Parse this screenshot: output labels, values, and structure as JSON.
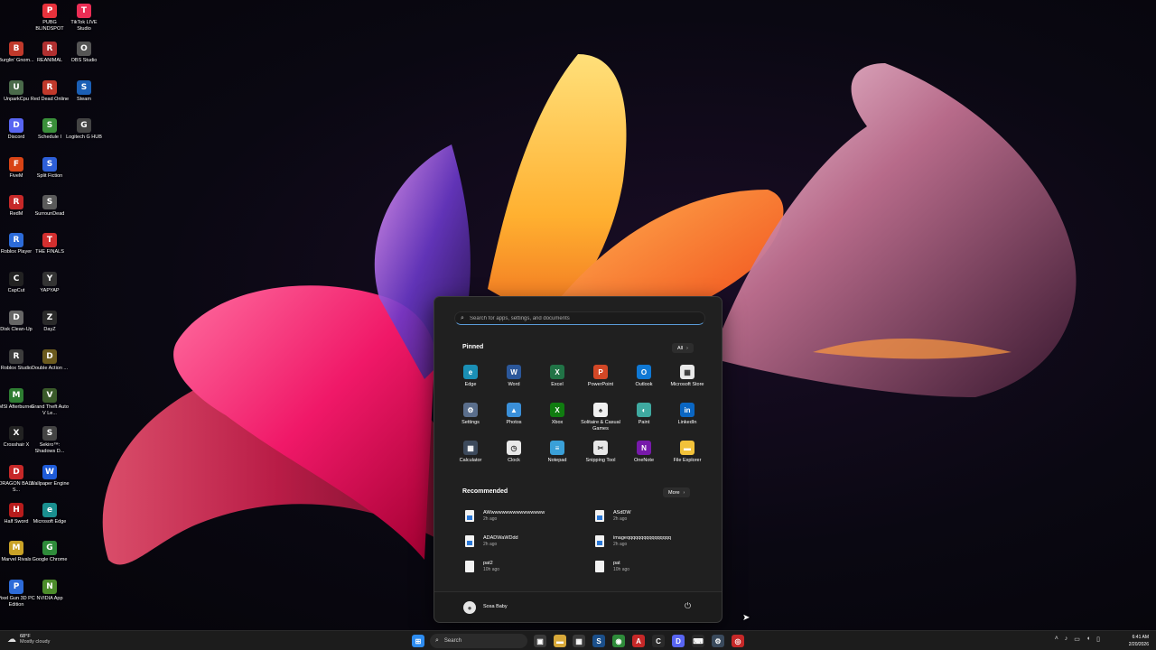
{
  "desktop": {
    "icons": [
      {
        "label": "PUBG BLINDSPOT",
        "color": "#e8323c",
        "glyph": "P"
      },
      {
        "label": "TikTok LIVE Studio",
        "color": "#ea2d55",
        "glyph": "T"
      },
      {
        "label": "Burglin' Gnom...",
        "color": "#c0392b",
        "glyph": "B"
      },
      {
        "label": "REANIMAL",
        "color": "#b03030",
        "glyph": "R"
      },
      {
        "label": "OBS Studio",
        "color": "#555555",
        "glyph": "O"
      },
      {
        "label": "UnparkCpu",
        "color": "#4a6a4a",
        "glyph": "U"
      },
      {
        "label": "Red Dead Online",
        "color": "#c0392b",
        "glyph": "R"
      },
      {
        "label": "Steam",
        "color": "#1b5fb5",
        "glyph": "S"
      },
      {
        "label": "Discord",
        "color": "#5865f2",
        "glyph": "D"
      },
      {
        "label": "Schedule I",
        "color": "#3a8f3a",
        "glyph": "S"
      },
      {
        "label": "Logitech G HUB",
        "color": "#444444",
        "glyph": "G"
      },
      {
        "label": "FiveM",
        "color": "#d84315",
        "glyph": "F"
      },
      {
        "label": "Split Fiction",
        "color": "#2d5fd8",
        "glyph": "S"
      },
      {
        "label": "RedM",
        "color": "#c62828",
        "glyph": "R"
      },
      {
        "label": "SurrounDead",
        "color": "#5a5a5a",
        "glyph": "S"
      },
      {
        "label": "Roblox Player",
        "color": "#2c6bd8",
        "glyph": "R"
      },
      {
        "label": "THE FINALS",
        "color": "#d32f2f",
        "glyph": "T"
      },
      {
        "label": "CapCut",
        "color": "#222222",
        "glyph": "C"
      },
      {
        "label": "YAPYAP",
        "color": "#333333",
        "glyph": "Y"
      },
      {
        "label": "Disk Clean-Up",
        "color": "#666666",
        "glyph": "D"
      },
      {
        "label": "DayZ",
        "color": "#2a2a2a",
        "glyph": "Z"
      },
      {
        "label": "Roblox Studio",
        "color": "#3c3c3c",
        "glyph": "R"
      },
      {
        "label": "Double Action ...",
        "color": "#6b5a1e",
        "glyph": "D"
      },
      {
        "label": "MSI Afterburner",
        "color": "#2e7d32",
        "glyph": "M"
      },
      {
        "label": "Grand Theft Auto V Le...",
        "color": "#3a5a2a",
        "glyph": "V"
      },
      {
        "label": "Crosshair X",
        "color": "#222222",
        "glyph": "X"
      },
      {
        "label": "Sekiro™: Shadows D...",
        "color": "#444444",
        "glyph": "S"
      },
      {
        "label": "DRAGON BALL S...",
        "color": "#c62828",
        "glyph": "D"
      },
      {
        "label": "Wallpaper Engine",
        "color": "#1e5bd8",
        "glyph": "W"
      },
      {
        "label": "Half Sword",
        "color": "#b71c1c",
        "glyph": "H"
      },
      {
        "label": "Microsoft Edge",
        "color": "#1a8f8f",
        "glyph": "e"
      },
      {
        "label": "Marvel Rivals",
        "color": "#c9a227",
        "glyph": "M"
      },
      {
        "label": "Google Chrome",
        "color": "#2e8b3a",
        "glyph": "G"
      },
      {
        "label": "Pixel Gun 3D PC Edition",
        "color": "#2d6bd8",
        "glyph": "P"
      },
      {
        "label": "NVIDIA App",
        "color": "#4c8c2b",
        "glyph": "N"
      }
    ]
  },
  "start_menu": {
    "search_placeholder": "Search for apps, settings, and documents",
    "pinned_title": "Pinned",
    "all_label": "All",
    "pinned": [
      {
        "label": "Edge",
        "color": "#1a8fb5",
        "glyph": "e",
        "icon": "edge-icon"
      },
      {
        "label": "Word",
        "color": "#2b579a",
        "glyph": "W",
        "icon": "word-icon"
      },
      {
        "label": "Excel",
        "color": "#217346",
        "glyph": "X",
        "icon": "excel-icon"
      },
      {
        "label": "PowerPoint",
        "color": "#d24726",
        "glyph": "P",
        "icon": "powerpoint-icon"
      },
      {
        "label": "Outlook",
        "color": "#0f78d4",
        "glyph": "O",
        "icon": "outlook-icon"
      },
      {
        "label": "Microsoft Store",
        "color": "#e9e9e9",
        "glyph": "▦",
        "icon": "store-icon"
      },
      {
        "label": "Settings",
        "color": "#5a6e8c",
        "glyph": "⚙",
        "icon": "settings-icon"
      },
      {
        "label": "Photos",
        "color": "#3a8fd8",
        "glyph": "▲",
        "icon": "photos-icon"
      },
      {
        "label": "Xbox",
        "color": "#107c10",
        "glyph": "X",
        "icon": "xbox-icon"
      },
      {
        "label": "Solitaire & Casual Games",
        "color": "#f0f0f0",
        "glyph": "♠",
        "icon": "solitaire-icon"
      },
      {
        "label": "Paint",
        "color": "#3fa9a0",
        "glyph": "◐",
        "icon": "paint-icon"
      },
      {
        "label": "LinkedIn",
        "color": "#0a66c2",
        "glyph": "in",
        "icon": "linkedin-icon"
      },
      {
        "label": "Calculator",
        "color": "#3d4a5c",
        "glyph": "▦",
        "icon": "calculator-icon"
      },
      {
        "label": "Clock",
        "color": "#e8e8e8",
        "glyph": "◷",
        "icon": "clock-icon"
      },
      {
        "label": "Notepad",
        "color": "#3aa0d8",
        "glyph": "≡",
        "icon": "notepad-icon"
      },
      {
        "label": "Snipping Tool",
        "color": "#e8e8e8",
        "glyph": "✂",
        "icon": "snipping-tool-icon"
      },
      {
        "label": "OneNote",
        "color": "#7719aa",
        "glyph": "N",
        "icon": "onenote-icon"
      },
      {
        "label": "File Explorer",
        "color": "#f2c23a",
        "glyph": "▬",
        "icon": "file-explorer-icon"
      }
    ],
    "recommended_title": "Recommended",
    "more_label": "More",
    "recommended": [
      {
        "name": "AWwwwwwwwwwwwwwww",
        "time": "2h ago",
        "kind": "word"
      },
      {
        "name": "ASdDW",
        "time": "2h ago",
        "kind": "word"
      },
      {
        "name": "ADADWaWDdd",
        "time": "2h ago",
        "kind": "word"
      },
      {
        "name": "imageqqqqqqqqqqqqqqqq",
        "time": "2h ago",
        "kind": "word"
      },
      {
        "name": "pat2",
        "time": "10h ago",
        "kind": "text"
      },
      {
        "name": "pat",
        "time": "10h ago",
        "kind": "text"
      }
    ],
    "user_name": "Sosa Baby"
  },
  "taskbar": {
    "weather_temp": "68°F",
    "weather_desc": "Mostly cloudy",
    "search_label": "Search",
    "time": "6:41 AM",
    "date": "2/20/2026",
    "apps": [
      {
        "icon": "windows-start-icon",
        "color": "#2d8cf0",
        "glyph": "⊞"
      },
      {
        "icon": "copilot-icon",
        "color": "#c2903a",
        "glyph": "✿"
      },
      {
        "icon": "task-view-icon",
        "color": "#3a3a3a",
        "glyph": "▣"
      },
      {
        "icon": "file-explorer-icon",
        "color": "#d8a93a",
        "glyph": "▬"
      },
      {
        "icon": "store-icon",
        "color": "#3a3a3a",
        "glyph": "▦"
      },
      {
        "icon": "steam-icon",
        "color": "#1b4f8a",
        "glyph": "S"
      },
      {
        "icon": "chrome-icon",
        "color": "#2e8b3a",
        "glyph": "◉"
      },
      {
        "icon": "adobe-icon",
        "color": "#c62828",
        "glyph": "A"
      },
      {
        "icon": "capcut-icon",
        "color": "#2a2a2a",
        "glyph": "C"
      },
      {
        "icon": "discord-icon",
        "color": "#5865f2",
        "glyph": "D"
      },
      {
        "icon": "terminal-icon",
        "color": "#2a2a2a",
        "glyph": "⌨"
      },
      {
        "icon": "settings-icon",
        "color": "#3a4a5c",
        "glyph": "⚙"
      },
      {
        "icon": "game-app-icon",
        "color": "#c62828",
        "glyph": "◎"
      }
    ]
  }
}
